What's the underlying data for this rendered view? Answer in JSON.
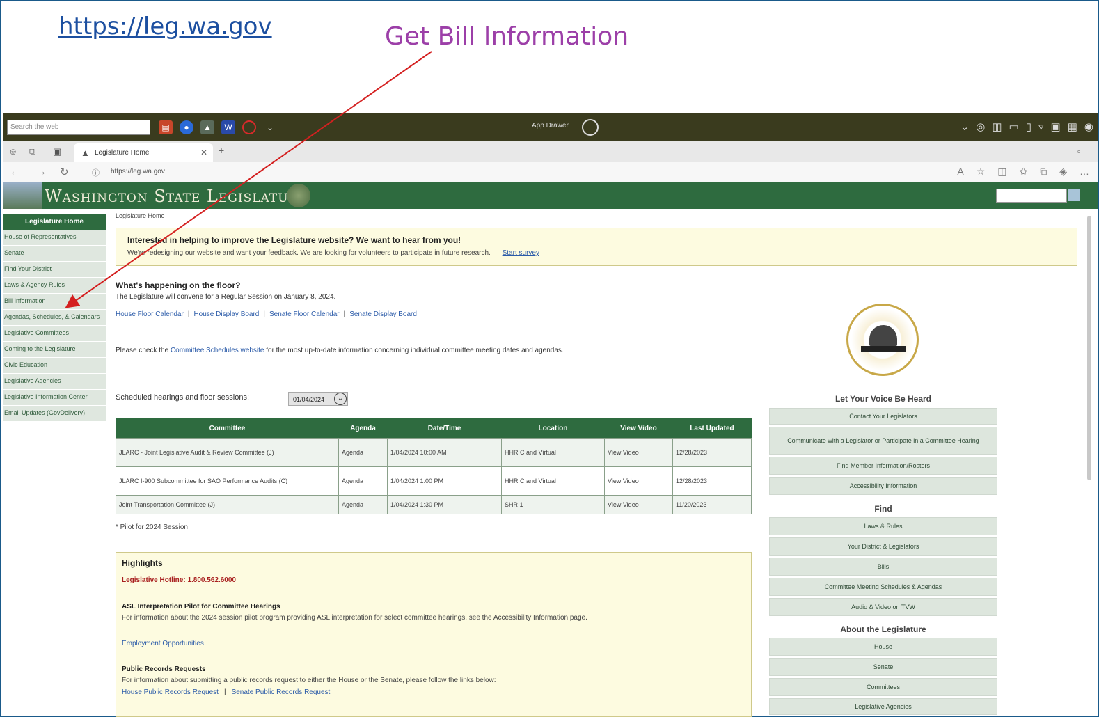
{
  "slide": {
    "url_text": "https://leg.wa.gov",
    "title": "Get Bill Information"
  },
  "taskbar": {
    "search_placeholder": "Search the web",
    "center_label": "App Drawer"
  },
  "browser": {
    "tab_title": "Legislature Home",
    "address": "https://leg.wa.gov"
  },
  "site": {
    "banner_title": "Washington State Legislature",
    "breadcrumb": "Legislature Home"
  },
  "leftnav": {
    "header": "Legislature Home",
    "items": [
      "House of Representatives",
      "Senate",
      "Find Your District",
      "Laws & Agency Rules",
      "Bill Information",
      "Agendas, Schedules, & Calendars",
      "Legislative Committees",
      "Coming to the Legislature",
      "Civic Education",
      "Legislative Agencies",
      "Legislative Information Center",
      "Email Updates (GovDelivery)"
    ]
  },
  "survey": {
    "heading": "Interested in helping to improve the Legislature website? We want to hear from you!",
    "text": "We're redesigning our website and want your feedback. We are looking for volunteers to participate in future research.",
    "link": "Start survey"
  },
  "floor": {
    "heading": "What's happening on the floor?",
    "text": "The Legislature will convene for a Regular Session on January 8, 2024.",
    "links": [
      "House Floor Calendar",
      "House Display Board",
      "Senate Floor Calendar",
      "Senate Display Board"
    ],
    "check_prefix": "Please check the ",
    "check_link": "Committee Schedules website",
    "check_suffix": " for the most up-to-date information concerning individual committee meeting dates and agendas."
  },
  "schedule": {
    "label": "Scheduled hearings and floor sessions:",
    "date": "01/04/2024",
    "columns": [
      "Committee",
      "Agenda",
      "Date/Time",
      "Location",
      "View Video",
      "Last Updated"
    ],
    "rows": [
      [
        "JLARC - Joint Legislative Audit & Review Committee (J)",
        "Agenda",
        "1/04/2024 10:00 AM",
        "HHR C and Virtual",
        "View Video",
        "12/28/2023"
      ],
      [
        "JLARC I-900 Subcommittee for SAO Performance Audits (C)",
        "Agenda",
        "1/04/2024 1:00 PM",
        "HHR C and Virtual",
        "View Video",
        "12/28/2023"
      ],
      [
        "Joint Transportation Committee (J)",
        "Agenda",
        "1/04/2024 1:30 PM",
        "SHR 1",
        "View Video",
        "11/20/2023"
      ]
    ],
    "pilot_note": "* Pilot for 2024 Session"
  },
  "highlights": {
    "heading": "Highlights",
    "hotline": "Legislative Hotline: 1.800.562.6000",
    "asl_heading": "ASL Interpretation Pilot for Committee Hearings",
    "asl_text": "For information about the 2024 session pilot program providing ASL interpretation for select committee hearings, see the Accessibility Information page.",
    "employment": "Employment Opportunities",
    "prr_heading": "Public Records Requests",
    "prr_text": "For information about submitting a public records request to either the House or the Senate, please follow the links below:",
    "prr_links": [
      "House Public Records Request",
      "Senate Public Records Request"
    ]
  },
  "right": {
    "voice_heading": "Let Your Voice Be Heard",
    "voice_buttons": [
      "Contact Your Legislators",
      "Communicate with a Legislator or Participate in a Committee Hearing",
      "Find Member Information/Rosters",
      "Accessibility Information"
    ],
    "find_heading": "Find",
    "find_buttons": [
      "Laws & Rules",
      "Your District & Legislators",
      "Bills",
      "Committee Meeting Schedules & Agendas",
      "Audio & Video on TVW"
    ],
    "about_heading": "About the Legislature",
    "about_buttons": [
      "House",
      "Senate",
      "Committees",
      "Legislative Agencies"
    ]
  },
  "colors": {
    "brand_green": "#2e6b3f",
    "annotation_red": "#d42020",
    "title_purple": "#9c3fa8",
    "link_blue": "#1c4fa0"
  }
}
